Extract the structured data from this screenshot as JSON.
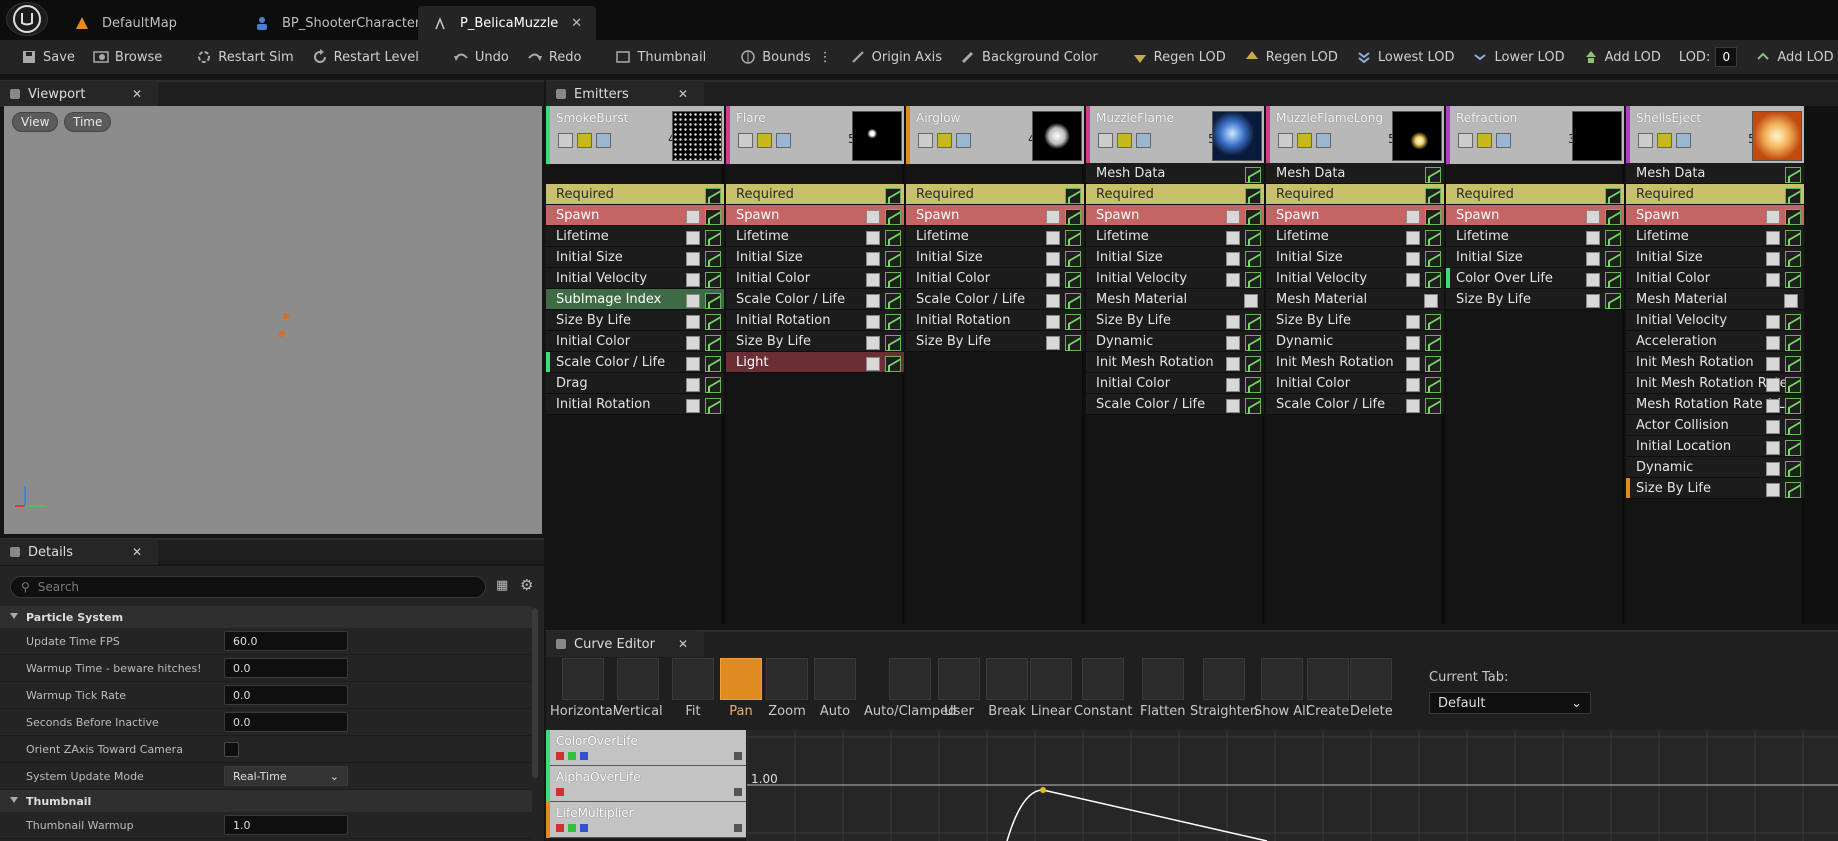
{
  "tabs": [
    {
      "label": "DefaultMap",
      "active": false
    },
    {
      "label": "BP_ShooterCharacter",
      "active": false
    },
    {
      "label": "P_BelicaMuzzle",
      "active": true
    }
  ],
  "toolbar": {
    "save": "Save",
    "browse": "Browse",
    "restart_sim": "Restart Sim",
    "restart_level": "Restart Level",
    "undo": "Undo",
    "redo": "Redo",
    "thumbnail": "Thumbnail",
    "bounds": "Bounds",
    "origin_axis": "Origin Axis",
    "background_color": "Background Color",
    "regen_lod_1": "Regen LOD",
    "regen_lod_2": "Regen LOD",
    "lowest_lod": "Lowest LOD",
    "lower_lod": "Lower LOD",
    "add_lod_1": "Add LOD",
    "lod_label": "LOD:",
    "lod_value": "0",
    "add_lod_2": "Add LOD"
  },
  "viewport": {
    "title": "Viewport",
    "view_btn": "View",
    "time_btn": "Time"
  },
  "details": {
    "title": "Details",
    "search_placeholder": "Search",
    "sections": [
      {
        "label": "Particle System"
      },
      {
        "label": "Thumbnail"
      }
    ],
    "rows": [
      {
        "label": "Update Time FPS",
        "value": "60.0"
      },
      {
        "label": "Warmup Time - beware hitches!",
        "value": "0.0"
      },
      {
        "label": "Warmup Tick Rate",
        "value": "0.0"
      },
      {
        "label": "Seconds Before Inactive",
        "value": "0.0"
      },
      {
        "label": "Orient ZAxis Toward Camera",
        "value": ""
      },
      {
        "label": "System Update Mode",
        "value": "Real-Time"
      },
      {
        "label": "Thumbnail Warmup",
        "value": "1.0"
      }
    ]
  },
  "emitters": {
    "title": "Emitters",
    "columns": [
      {
        "name": "SmokeBurst",
        "count": "4",
        "color": "#3ddc7a",
        "modules": [
          "Required",
          "Spawn",
          "Lifetime",
          "Initial Size",
          "Initial Velocity",
          "SubImage Index",
          "Size By Life",
          "Initial Color",
          "Scale Color / Life",
          "Drag",
          "Initial Rotation"
        ]
      },
      {
        "name": "Flare",
        "count": "5",
        "color": "#d23c8c",
        "modules": [
          "Required",
          "Spawn",
          "Lifetime",
          "Initial Size",
          "Initial Color",
          "Scale Color / Life",
          "Initial Rotation",
          "Size By Life",
          "Light"
        ]
      },
      {
        "name": "Airglow",
        "count": "4",
        "color": "#e08b1f",
        "modules": [
          "Required",
          "Spawn",
          "Lifetime",
          "Initial Size",
          "Initial Color",
          "Scale Color / Life",
          "Initial Rotation",
          "Size By Life"
        ]
      },
      {
        "name": "MuzzleFlame",
        "count": "5",
        "color": "#d23c8c",
        "modules": [
          "Mesh Data",
          "Required",
          "Spawn",
          "Lifetime",
          "Initial Size",
          "Initial Velocity",
          "Mesh Material",
          "Size By Life",
          "Dynamic",
          "Init Mesh Rotation",
          "Initial Color",
          "Scale Color / Life"
        ]
      },
      {
        "name": "MuzzleFlameLong",
        "count": "5",
        "color": "#d23c8c",
        "modules": [
          "Mesh Data",
          "Required",
          "Spawn",
          "Lifetime",
          "Initial Size",
          "Initial Velocity",
          "Mesh Material",
          "Size By Life",
          "Dynamic",
          "Init Mesh Rotation",
          "Initial Color",
          "Scale Color / Life"
        ]
      },
      {
        "name": "Refraction",
        "count": "3",
        "color": "#b03cc8",
        "modules": [
          "Required",
          "Spawn",
          "Lifetime",
          "Initial Size",
          "Color Over Life",
          "Size By Life"
        ]
      },
      {
        "name": "ShellsEject",
        "count": "5",
        "color": "#b03cc8",
        "modules": [
          "Mesh Data",
          "Required",
          "Spawn",
          "Lifetime",
          "Initial Size",
          "Initial Color",
          "Mesh Material",
          "Initial Velocity",
          "Acceleration",
          "Init Mesh Rotation",
          "Init Mesh Rotation Rate",
          "Mesh Rotation Rate * L",
          "Actor Collision",
          "Initial Location",
          "Dynamic",
          "Size By Life"
        ]
      }
    ]
  },
  "curve_editor": {
    "title": "Curve Editor",
    "buttons": [
      "Horizontal",
      "Vertical",
      "Fit",
      "Pan",
      "Zoom",
      "Auto",
      "Auto/Clamped",
      "User",
      "Break",
      "Linear",
      "Constant",
      "Flatten",
      "Straighten",
      "Show All",
      "Create",
      "Delete"
    ],
    "active_button": "Pan",
    "current_tab_label": "Current Tab:",
    "current_tab_value": "Default",
    "tracks": [
      {
        "name": "ColorOverLife",
        "color": "#3ddc7a"
      },
      {
        "name": "AlphaOverLife",
        "color": "#3ddc7a"
      },
      {
        "name": "LifeMultiplier",
        "color": "#e08b1f"
      }
    ],
    "y_label": "1.00"
  },
  "colors": {
    "accent": "#e08b1f",
    "required": "#c8c06a",
    "spawn": "#c56464"
  }
}
